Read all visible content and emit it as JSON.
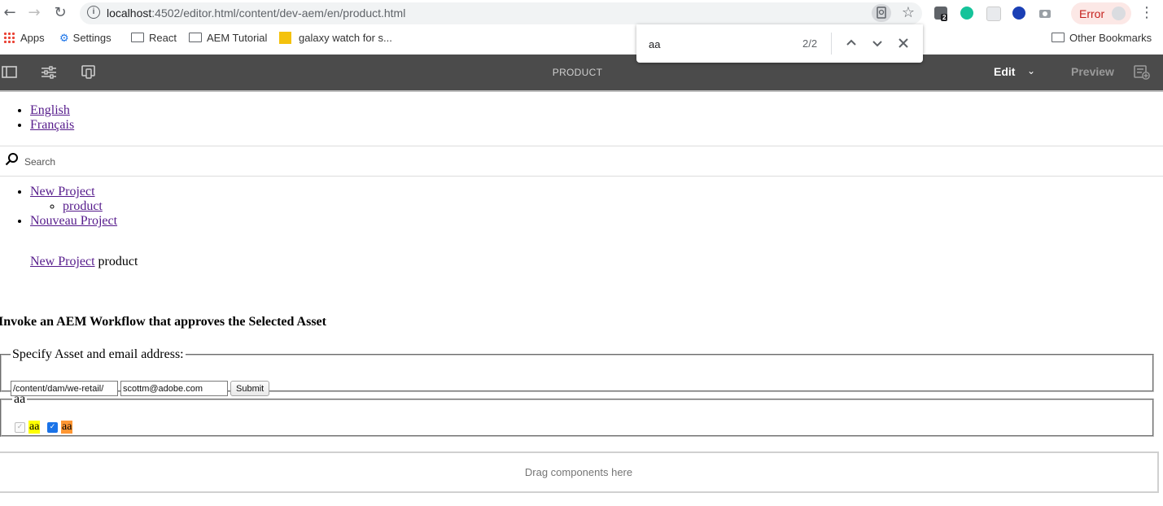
{
  "browser": {
    "url_host": "localhost",
    "url_rest": ":4502/editor.html/content/dev-aem/en/product.html",
    "error_label": "Error",
    "extension_badge": "2",
    "bookmarks": [
      {
        "label": "Apps",
        "icon": "apps-grid-icon"
      },
      {
        "label": "Settings",
        "icon": "gear-icon"
      },
      {
        "label": "React",
        "icon": "folder-icon"
      },
      {
        "label": "AEM Tutorial",
        "icon": "folder-icon"
      },
      {
        "label": "galaxy watch for s...",
        "icon": "bookmark-favicon"
      }
    ],
    "other_bookmarks": "Other Bookmarks"
  },
  "findbar": {
    "query": "aa",
    "count": "2/2"
  },
  "editor": {
    "page_title": "PRODUCT",
    "mode_edit": "Edit",
    "mode_preview": "Preview"
  },
  "content": {
    "languages": [
      "English",
      "Français"
    ],
    "search_placeholder": "Search",
    "nav": {
      "project": "New Project",
      "child": "product",
      "project_fr": "Nouveau Project"
    },
    "breadcrumb": {
      "link": "New Project",
      "current": "product"
    },
    "heading": "Invoke an AEM Workflow that approves the Selected Asset",
    "form": {
      "legend": "Specify Asset and email address:",
      "asset_value": "/content/dam/we-retail/",
      "email_value": "scottm@adobe.com",
      "submit_label": "Submit"
    },
    "checkbox_group": {
      "legend": "aa",
      "labels": [
        "aa",
        "aa"
      ]
    },
    "dropzone_text": "Drag components here"
  },
  "colors": {
    "editor_bar": "#4b4b4b",
    "find_highlight": "#ffff00",
    "find_active_highlight": "#ff9632",
    "link": "#551a8b"
  }
}
